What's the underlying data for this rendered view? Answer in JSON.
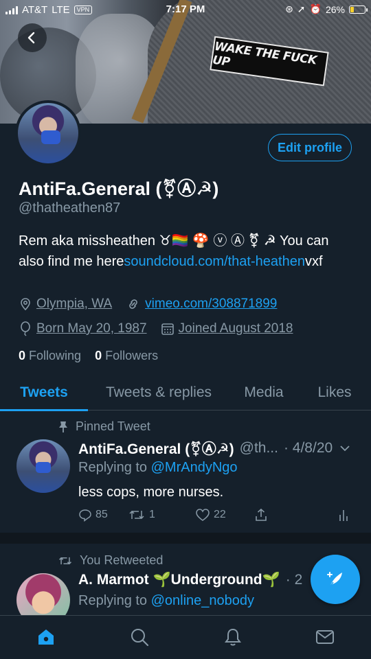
{
  "status_bar": {
    "carrier": "AT&T",
    "network": "LTE",
    "vpn": "VPN",
    "time": "7:17 PM",
    "battery_percent": "26%",
    "battery_level": 0.26
  },
  "banner": {
    "sticker_text": "WAKE THE FUCK UP"
  },
  "profile": {
    "edit_label": "Edit profile",
    "name": "AntiFa.General (⚧Ⓐ☭)",
    "handle": "@thatheathen87",
    "bio_text": "Rem aka missheathen ♉🏳️‍🌈 🍄 ⓥ Ⓐ ⚧ ☭ You can also find me here",
    "bio_link": "soundcloud.com/that-heathen",
    "bio_suffix": "vxf",
    "location": "Olympia, WA",
    "website": "vimeo.com/308871899",
    "birthday": "Born May 20, 1987",
    "joined": "Joined August 2018",
    "following_count": "0",
    "following_label": "Following",
    "followers_count": "0",
    "followers_label": "Followers"
  },
  "tabs": [
    {
      "label": "Tweets",
      "active": true
    },
    {
      "label": "Tweets & replies",
      "active": false
    },
    {
      "label": "Media",
      "active": false
    },
    {
      "label": "Likes",
      "active": false
    }
  ],
  "tweets": [
    {
      "context": "Pinned Tweet",
      "name": "AntiFa.General (⚧Ⓐ☭)",
      "handle": "@th...",
      "date": "· 4/8/20",
      "replying_label": "Replying to",
      "replying_to": "@MrAndyNgo",
      "text": "less cops, more nurses.",
      "replies": "85",
      "retweets": "1",
      "likes": "22"
    },
    {
      "context": "You Retweeted",
      "name": "A. Marmot 🌱Underground🌱",
      "date": "· 2",
      "replying_label": "Replying to",
      "replying_to": "@online_nobody"
    }
  ],
  "bottom_nav": [
    "home-icon",
    "search-icon",
    "bell-icon",
    "mail-icon"
  ],
  "colors": {
    "background": "#15202b",
    "accent": "#1da1f2",
    "secondary_text": "#8899a6"
  }
}
